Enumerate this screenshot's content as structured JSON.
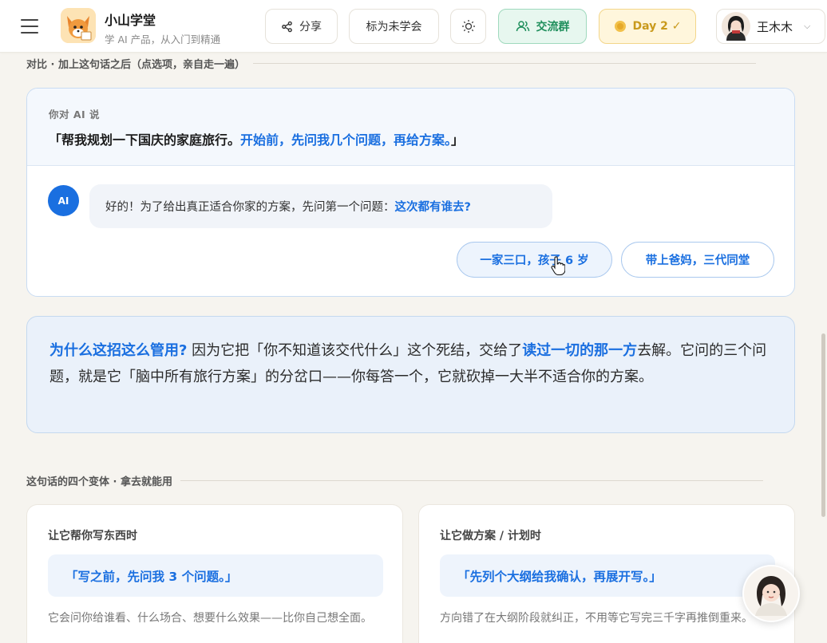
{
  "header": {
    "brand_title": "小山学堂",
    "brand_subtitle": "学 AI 产品，从入门到精通",
    "share_label": "分享",
    "mark_label": "标为未学会",
    "group_label": "交流群",
    "day_label": "Day 2 ✓",
    "user_name": "王木木"
  },
  "compare_section": {
    "label": "对比 · 加上这句话之后（点选项，亲自走一遍）",
    "you_say": "你对 AI 说",
    "prompt_plain": "「帮我规划一下国庆的家庭旅行。",
    "prompt_highlight": "开始前，先问我几个问题，再给方案。",
    "prompt_end": "」",
    "ai_avatar": "AI",
    "ai_reply_plain": "好的！为了给出真正适合你家的方案，先问第一个问题：",
    "ai_reply_question": "这次都有谁去?",
    "options": [
      "一家三口，孩子 6 岁",
      "带上爸妈，三代同堂"
    ]
  },
  "explanation": {
    "lead": "为什么这招这么管用?",
    "part1": " 因为它把「你不知道该交代什么」这个死结，交给了",
    "highlight": "读过一切的那一方",
    "part2": "去解。它问的三个问题，就是它「脑中所有旅行方案」的分岔口——你每答一个，它就砍掉一大半不适合你的方案。"
  },
  "variants_section": {
    "label": "这句话的四个变体 · 拿去就能用",
    "cards": [
      {
        "title": "让它帮你写东西时",
        "quote": "「写之前，先问我 3 个问题。」",
        "desc": "它会问你给谁看、什么场合、想要什么效果——比你自己想全面。"
      },
      {
        "title": "让它做方案 / 计划时",
        "quote": "「先列个大纲给我确认，再展开写。」",
        "desc": "方向错了在大纲阶段就纠正，不用等它写完三千字再推倒重来。"
      }
    ]
  },
  "colors": {
    "accent_blue": "#1a6fe0",
    "group_green": "#1f8f5c",
    "day_gold": "#c99a1c"
  },
  "icons": [
    "menu-icon",
    "share-icon",
    "sun-icon",
    "users-icon",
    "coin-icon",
    "chevron-down-icon",
    "cursor-hand-icon"
  ]
}
